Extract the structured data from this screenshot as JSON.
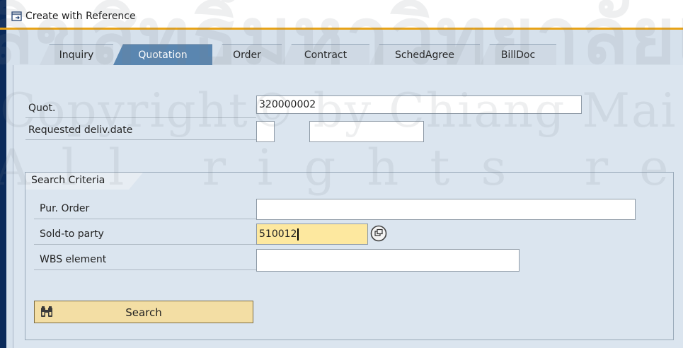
{
  "window": {
    "title": "Create with Reference"
  },
  "tabs": [
    {
      "label": "Inquiry",
      "active": false
    },
    {
      "label": "Quotation",
      "active": true
    },
    {
      "label": "Order",
      "active": false
    },
    {
      "label": "Contract",
      "active": false
    },
    {
      "label": "SchedAgree",
      "active": false
    },
    {
      "label": "BillDoc",
      "active": false
    }
  ],
  "form": {
    "quot": {
      "label": "Quot.",
      "value": "320000002"
    },
    "requested_deliv_date": {
      "label": "Requested deliv.date",
      "value_1": "",
      "value_2": ""
    }
  },
  "search_criteria": {
    "title": "Search Criteria",
    "pur_order": {
      "label": "Pur. Order",
      "value": ""
    },
    "sold_to_party": {
      "label": "Sold-to party",
      "value": "510012"
    },
    "wbs_element": {
      "label": "WBS element",
      "value": ""
    },
    "search_button": {
      "label": "Search",
      "icon": "binoculars-icon"
    },
    "f4_help_icon": "value-help-icon"
  },
  "watermark": {
    "line1": "ลิขสิทธิ์มหาวิทยาลัยเชียงใหม่",
    "line2": "Copyright© by Chiang Mai University",
    "line3": "All rights reserved"
  },
  "colors": {
    "active_tab": "#5a86b0",
    "title_accent": "#e8a317",
    "input_highlight": "#fde89f",
    "button_bg": "#f3dea4"
  }
}
